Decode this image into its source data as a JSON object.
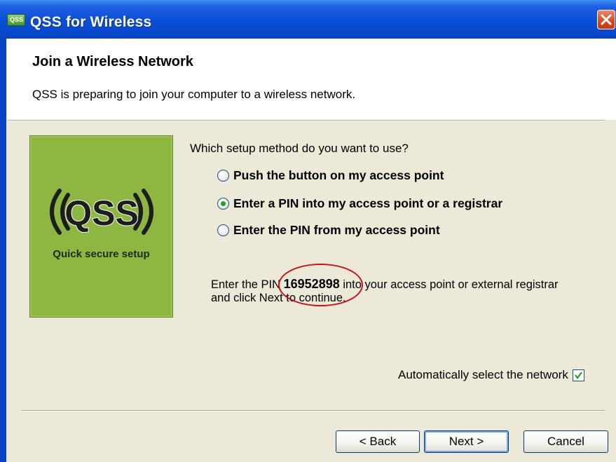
{
  "window": {
    "title": "QSS for Wireless",
    "icon": "qss-app-icon",
    "icon_text": "QSS"
  },
  "header": {
    "title": "Join a Wireless Network",
    "subtitle": "QSS is preparing to join your computer to a wireless network."
  },
  "logo": {
    "text": "QSS",
    "caption": "Quick secure setup",
    "bg_color": "#8db742"
  },
  "setup": {
    "question": "Which setup method do you want to use?",
    "options": [
      {
        "label": "Push the button on my access point",
        "checked": false
      },
      {
        "label": "Enter a PIN into my access point or a registrar",
        "checked": true
      },
      {
        "label": "Enter the PIN from my access point",
        "checked": false
      }
    ]
  },
  "pin": {
    "prefix": "Enter the PIN ",
    "value": "16952898",
    "suffix_line1": " into your access point or external registrar",
    "line2": "and click Next to continue.",
    "highlight_color": "#c6121c"
  },
  "auto_select": {
    "label": "Automatically select the network",
    "checked": true
  },
  "buttons": {
    "back": "< Back",
    "next": "Next >",
    "cancel": "Cancel"
  },
  "colors": {
    "titlebar": "#0a4ed6",
    "radio_dot": "#21a121"
  }
}
